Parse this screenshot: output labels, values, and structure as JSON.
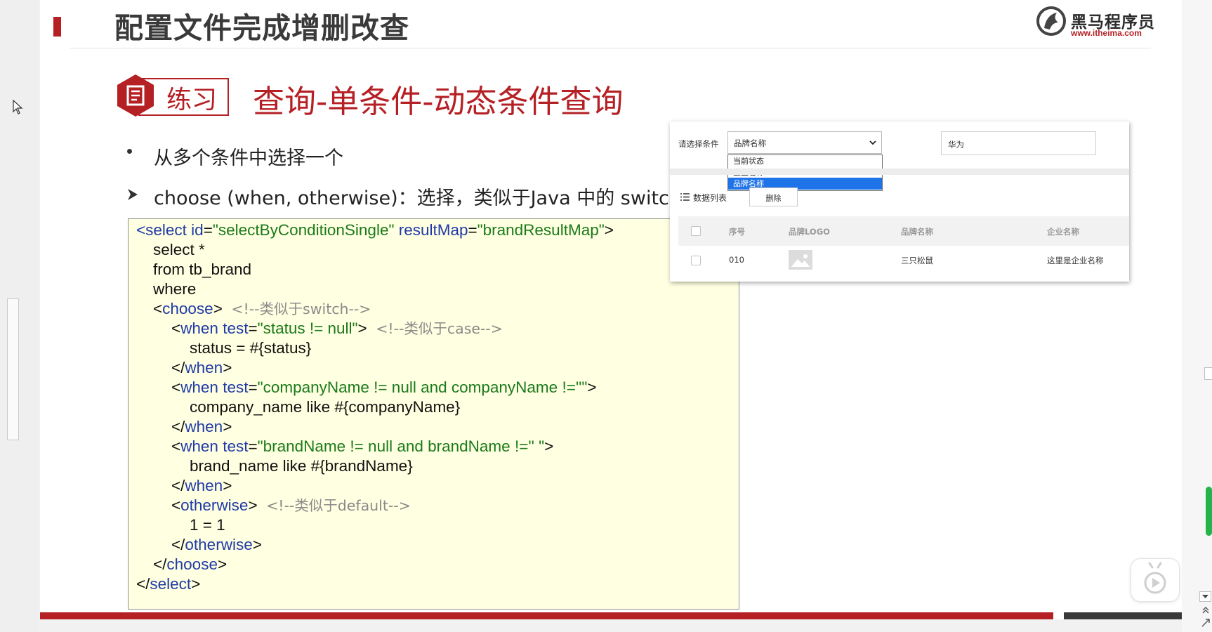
{
  "slide": {
    "title": "配置文件完成增删改查",
    "logo": {
      "name": "黑马程序员",
      "url": "www.itheima.com"
    },
    "badge_label": "练习",
    "section_heading": "查询-单条件-动态条件查询",
    "bullets": [
      "从多个条件中选择一个",
      "choose (when, otherwise)：选择，类似于Java 中的 switch 语句"
    ],
    "code": {
      "l1": {
        "open": "<",
        "tag": "select",
        "a1": " id",
        "eq1": "=",
        "v1": "\"selectByConditionSingle\"",
        "a2": " resultMap",
        "eq2": "=",
        "v2": "\"brandResultMap\"",
        "close": ">"
      },
      "l2": "select *",
      "l3": "from tb_brand",
      "l4": "where",
      "l5": {
        "open": "<",
        "tag": "choose",
        "close": ">",
        "comment": "<!--类似于switch-->"
      },
      "l6": {
        "open": "<",
        "tag": "when",
        "a1": " test",
        "eq1": "=",
        "v1": "\"status != null\"",
        "close": ">",
        "comment": "<!--类似于case-->"
      },
      "l7": "status = #{status}",
      "l8": {
        "open": "</",
        "tag": "when",
        "close": ">"
      },
      "l9": {
        "open": "<",
        "tag": "when",
        "a1": " test",
        "eq1": "=",
        "v1": "\"companyName != null and companyName !=''\"",
        "close": ">"
      },
      "l10": "company_name like #{companyName}",
      "l11": {
        "open": "</",
        "tag": "when",
        "close": ">"
      },
      "l12": {
        "open": "<",
        "tag": "when",
        "a1": " test",
        "eq1": "=",
        "v1": "\"brandName != null and brandName !='' \"",
        "close": ">"
      },
      "l13": "brand_name like #{brandName}",
      "l14": {
        "open": "</",
        "tag": "when",
        "close": ">"
      },
      "l15": {
        "open": "<",
        "tag": "otherwise",
        "close": ">",
        "comment": "<!--类似于default-->"
      },
      "l16": "1 = 1",
      "l17": {
        "open": "</",
        "tag": "otherwise",
        "close": ">"
      },
      "l18": {
        "open": "</",
        "tag": "choose",
        "close": ">"
      },
      "l19": {
        "open": "</",
        "tag": "select",
        "close": ">"
      }
    }
  },
  "demo": {
    "condition_label": "请选择条件",
    "selected_value": "品牌名称",
    "options": [
      "当前状态",
      "企业名称",
      "品牌名称"
    ],
    "search_value": "华为",
    "list_label": "数据列表",
    "delete_label": "删除",
    "columns": [
      "序号",
      "品牌LOGO",
      "品牌名称",
      "企业名称"
    ],
    "row": {
      "index": "010",
      "brand": "三只松鼠",
      "company": "这里是企业名称"
    }
  },
  "colors": {
    "accent": "#b52025",
    "code_bg": "#ffffe1",
    "code_tag": "#1f3aa8",
    "code_value": "#1a7a1a",
    "code_comment": "#8a8a8a",
    "selection": "#1e73e8"
  }
}
